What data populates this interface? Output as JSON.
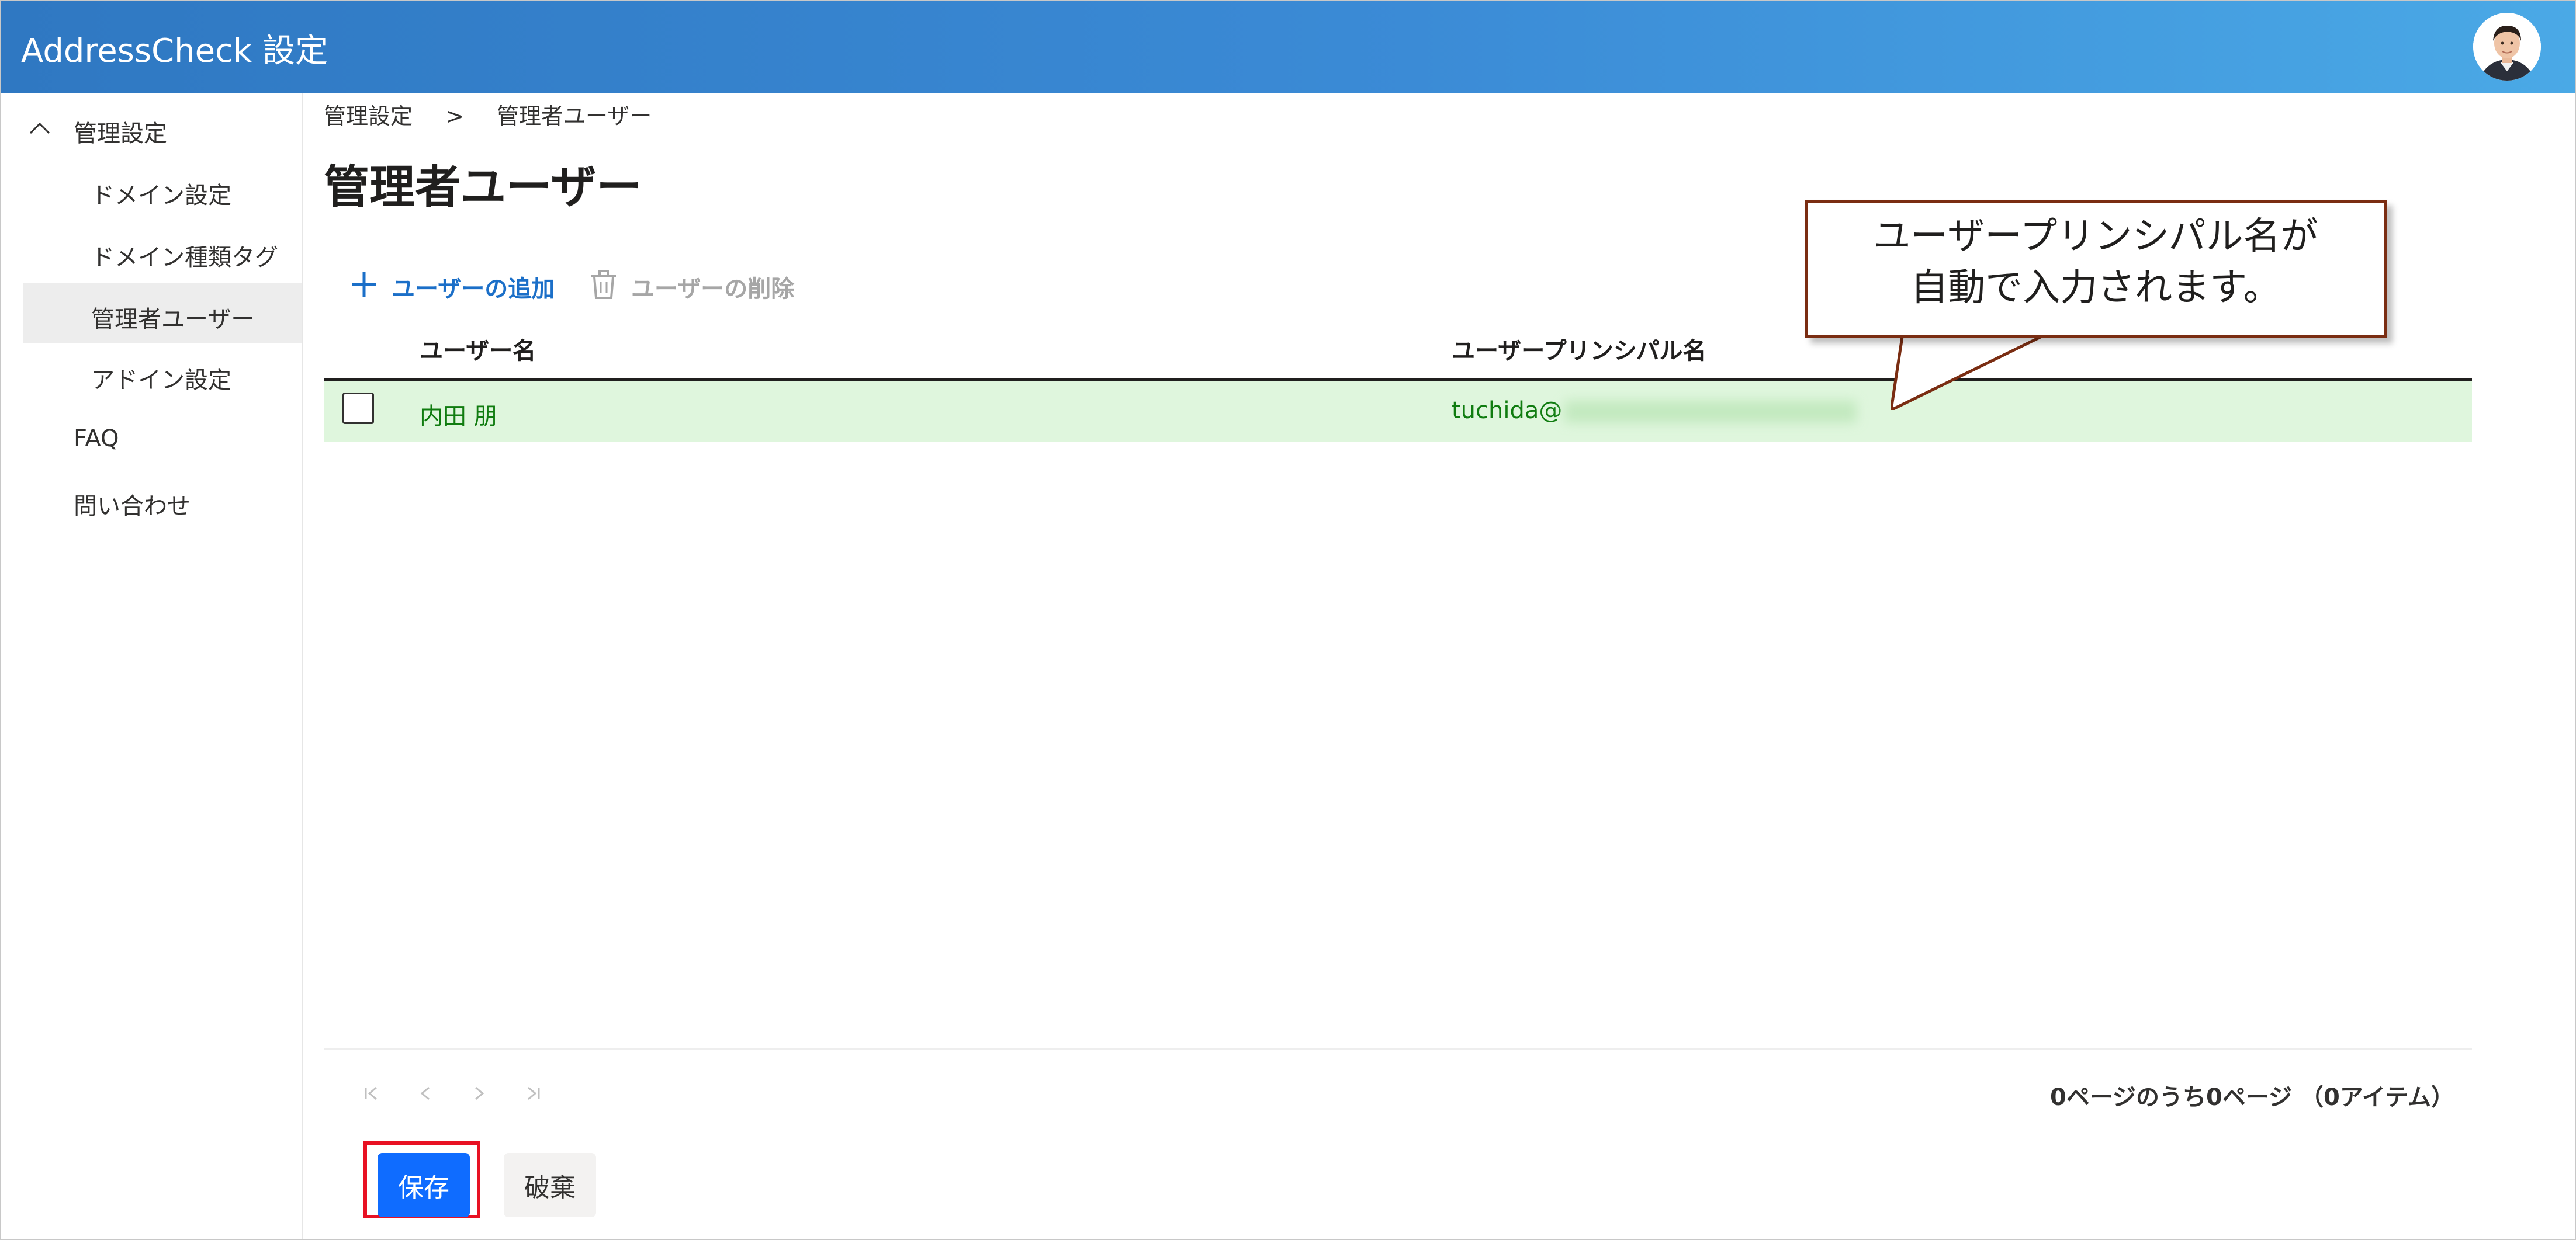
{
  "app": {
    "title": "AddressCheck 設定"
  },
  "header": {
    "avatar_icon": "user-avatar"
  },
  "sidebar": {
    "group_label": "管理設定",
    "group_icon": "chevron-up-icon",
    "items": [
      {
        "label": "ドメイン設定"
      },
      {
        "label": "ドメイン種類タグ"
      },
      {
        "label": "管理者ユーザー",
        "selected": true
      },
      {
        "label": "アドイン設定"
      }
    ],
    "faq_label": "FAQ",
    "contact_label": "問い合わせ"
  },
  "breadcrumb": {
    "parent": "管理設定",
    "separator": ">",
    "current": "管理者ユーザー"
  },
  "page": {
    "title": "管理者ユーザー"
  },
  "toolbar": {
    "add_label": "ユーザーの追加",
    "add_icon": "plus-icon",
    "delete_label": "ユーザーの削除",
    "delete_icon": "trash-icon"
  },
  "table": {
    "columns": [
      "ユーザー名",
      "ユーザープリンシパル名"
    ],
    "rows": [
      {
        "name": "内田 朋",
        "upn_prefix": "tuchida@"
      }
    ]
  },
  "pager": {
    "first_icon": "first-page-icon",
    "prev_icon": "prev-page-icon",
    "next_icon": "next-page-icon",
    "last_icon": "last-page-icon",
    "summary": "0ページのうち0ページ （0アイテム）"
  },
  "actions": {
    "save_label": "保存",
    "discard_label": "破棄"
  },
  "callout": {
    "line1": "ユーザープリンシパル名が",
    "line2": "自動で入力されます。"
  },
  "colors": {
    "header_start": "#2f78c2",
    "header_end": "#4aa9e6",
    "accent": "#1b6fc8",
    "row_highlight": "#dff6dd",
    "row_text": "#107c10",
    "save_button": "#0f6cff",
    "highlight_border": "#e81123",
    "callout_border": "#7a2d12"
  }
}
